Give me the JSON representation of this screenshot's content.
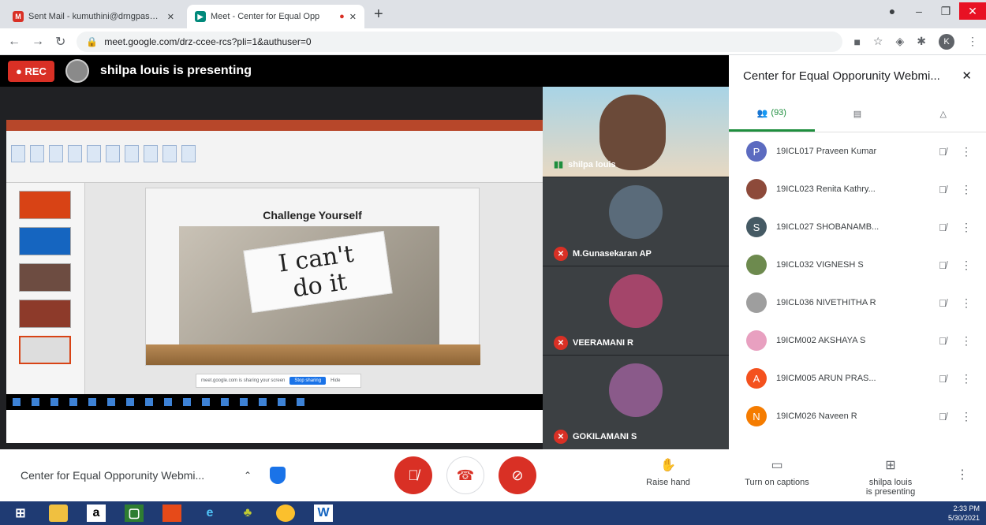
{
  "browser": {
    "tabs": [
      {
        "label": "Sent Mail - kumuthini@drngpasc.ac.in",
        "favicon": "M",
        "active": false
      },
      {
        "label": "Meet - Center for Equal Opp",
        "favicon": "▶",
        "active": true
      }
    ],
    "new_tab": "+",
    "url": "meet.google.com/drz-ccee-rcs?pli=1&authuser=0",
    "profile_initial": "K"
  },
  "stage": {
    "rec_label": "REC",
    "presenting_text": "shilpa louis is presenting",
    "slide": {
      "title": "Challenge Yourself",
      "card_text_line1": "I can't",
      "card_text_line2": "do it"
    },
    "share_bar": {
      "text": "meet.google.com is sharing your screen",
      "stop": "Stop sharing",
      "hide": "Hide"
    }
  },
  "tiles": [
    {
      "name": "shilpa louis",
      "muted": false,
      "avatar_color": "#6b4a39"
    },
    {
      "name": "M.Gunasekaran AP",
      "muted": true,
      "avatar_color": "#5a6b7a"
    },
    {
      "name": "VEERAMANI R",
      "muted": true,
      "avatar_color": "#a4456a"
    },
    {
      "name": "GOKILAMANI S",
      "muted": true,
      "avatar_color": "#8a5a8a"
    }
  ],
  "panel": {
    "title": "Center for Equal Opporunity Webmi...",
    "people_count": "(93)",
    "participants": [
      {
        "name": "19ICL017 Praveen Kumar",
        "initial": "P",
        "color": "#5c6bc0"
      },
      {
        "name": "19ICL023 Renita Kathry...",
        "initial": "",
        "color": "#8d4a3a"
      },
      {
        "name": "19ICL027 SHOBANAMB...",
        "initial": "S",
        "color": "#455a64"
      },
      {
        "name": "19ICL032 VIGNESH S",
        "initial": "",
        "color": "#6d8a4e"
      },
      {
        "name": "19ICL036 NIVETHITHA R",
        "initial": "",
        "color": "#9e9e9e"
      },
      {
        "name": "19ICM002 AKSHAYA S",
        "initial": "",
        "color": "#e8a0c0"
      },
      {
        "name": "19ICM005 ARUN PRAS...",
        "initial": "A",
        "color": "#f4511e"
      },
      {
        "name": "19ICM026 Naveen R",
        "initial": "N",
        "color": "#f57c00"
      }
    ]
  },
  "controls": {
    "meeting_title": "Center for Equal Opporunity Webmi...",
    "raise_hand": "Raise hand",
    "captions": "Turn on captions",
    "presenting_line1": "shilpa louis",
    "presenting_line2": "is presenting"
  },
  "taskbar": {
    "time": "2:33 PM",
    "date": "5/30/2021"
  },
  "colors": {
    "red": "#d93025",
    "green": "#1e8e3e",
    "blue": "#1a73e8"
  }
}
